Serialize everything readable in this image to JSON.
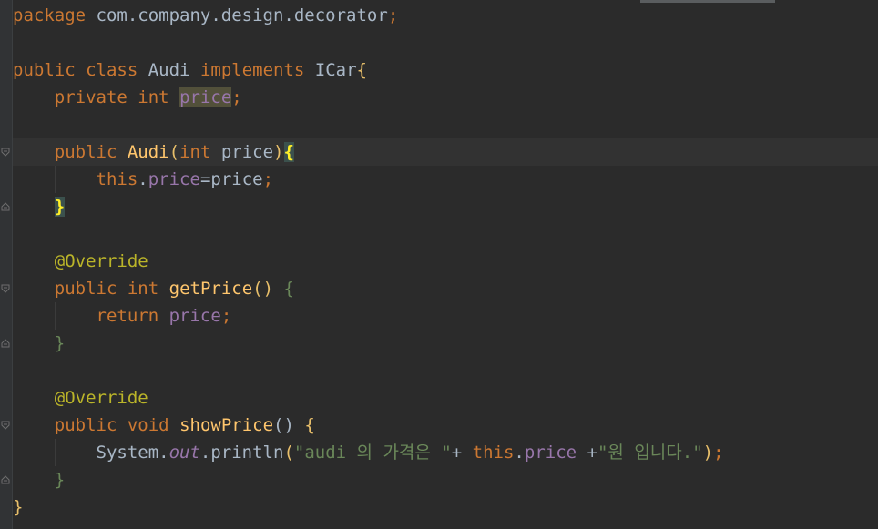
{
  "editor": {
    "language": "java",
    "colors": {
      "background": "#2b2b2b",
      "keyword": "#cc7832",
      "annotation": "#bbb529",
      "field": "#9876aa",
      "function": "#ffc66d",
      "string": "#6a8759",
      "plain": "#a9b7c6"
    },
    "lines": [
      [
        {
          "t": "package",
          "c": "kw"
        },
        {
          "t": " com.company.design.decorator",
          "c": ""
        },
        {
          "t": ";",
          "c": "kw"
        }
      ],
      [],
      [
        {
          "t": "public",
          "c": "kw"
        },
        {
          "t": " ",
          "c": ""
        },
        {
          "t": "class",
          "c": "kw"
        },
        {
          "t": " Audi ",
          "c": ""
        },
        {
          "t": "implements",
          "c": "kw"
        },
        {
          "t": " ICar",
          "c": ""
        },
        {
          "t": "{",
          "c": "br1"
        }
      ],
      [
        {
          "t": "    ",
          "c": ""
        },
        {
          "t": "private",
          "c": "kw"
        },
        {
          "t": " ",
          "c": ""
        },
        {
          "t": "int",
          "c": "kw"
        },
        {
          "t": " ",
          "c": ""
        },
        {
          "t": "price",
          "c": "fld hl-usage"
        },
        {
          "t": ";",
          "c": "kw"
        }
      ],
      [],
      [
        {
          "t": "    ",
          "c": ""
        },
        {
          "t": "public",
          "c": "kw"
        },
        {
          "t": " ",
          "c": ""
        },
        {
          "t": "Audi",
          "c": "fn"
        },
        {
          "t": "(",
          "c": "br1"
        },
        {
          "t": "int",
          "c": "kw"
        },
        {
          "t": " price",
          "c": ""
        },
        {
          "t": ")",
          "c": "br1"
        },
        {
          "t": "{",
          "c": "hl-match"
        }
      ],
      [
        {
          "t": "        ",
          "c": ""
        },
        {
          "t": "this",
          "c": "kw"
        },
        {
          "t": ".",
          "c": ""
        },
        {
          "t": "price",
          "c": "fld"
        },
        {
          "t": "=price",
          "c": ""
        },
        {
          "t": ";",
          "c": "kw"
        }
      ],
      [
        {
          "t": "    ",
          "c": ""
        },
        {
          "t": "}",
          "c": "hl-match"
        }
      ],
      [],
      [
        {
          "t": "    ",
          "c": ""
        },
        {
          "t": "@Override",
          "c": "ann"
        }
      ],
      [
        {
          "t": "    ",
          "c": ""
        },
        {
          "t": "public",
          "c": "kw"
        },
        {
          "t": " ",
          "c": ""
        },
        {
          "t": "int",
          "c": "kw"
        },
        {
          "t": " ",
          "c": ""
        },
        {
          "t": "getPrice",
          "c": "fn"
        },
        {
          "t": "()",
          "c": "br1"
        },
        {
          "t": " ",
          "c": ""
        },
        {
          "t": "{",
          "c": "br2"
        }
      ],
      [
        {
          "t": "        ",
          "c": ""
        },
        {
          "t": "return",
          "c": "kw"
        },
        {
          "t": " ",
          "c": ""
        },
        {
          "t": "price",
          "c": "fld"
        },
        {
          "t": ";",
          "c": "kw"
        }
      ],
      [
        {
          "t": "    ",
          "c": ""
        },
        {
          "t": "}",
          "c": "br2"
        }
      ],
      [],
      [
        {
          "t": "    ",
          "c": ""
        },
        {
          "t": "@Override",
          "c": "ann"
        }
      ],
      [
        {
          "t": "    ",
          "c": ""
        },
        {
          "t": "public",
          "c": "kw"
        },
        {
          "t": " ",
          "c": ""
        },
        {
          "t": "void",
          "c": "kw"
        },
        {
          "t": " ",
          "c": ""
        },
        {
          "t": "showPrice",
          "c": "fn"
        },
        {
          "t": "()",
          "c": ""
        },
        {
          "t": " ",
          "c": ""
        },
        {
          "t": "{",
          "c": "br1"
        }
      ],
      [
        {
          "t": "        System.",
          "c": ""
        },
        {
          "t": "out",
          "c": "sta"
        },
        {
          "t": ".println",
          "c": ""
        },
        {
          "t": "(",
          "c": "br1"
        },
        {
          "t": "\"audi 의 가격은 \"",
          "c": "str"
        },
        {
          "t": "+ ",
          "c": ""
        },
        {
          "t": "this",
          "c": "kw"
        },
        {
          "t": ".",
          "c": ""
        },
        {
          "t": "price",
          "c": "fld"
        },
        {
          "t": " +",
          "c": ""
        },
        {
          "t": "\"원 입니다.\"",
          "c": "str"
        },
        {
          "t": ")",
          "c": "br1"
        },
        {
          "t": ";",
          "c": "kw"
        }
      ],
      [
        {
          "t": "    ",
          "c": ""
        },
        {
          "t": "}",
          "c": "br2"
        }
      ],
      [
        {
          "t": "}",
          "c": "br1"
        }
      ]
    ]
  }
}
